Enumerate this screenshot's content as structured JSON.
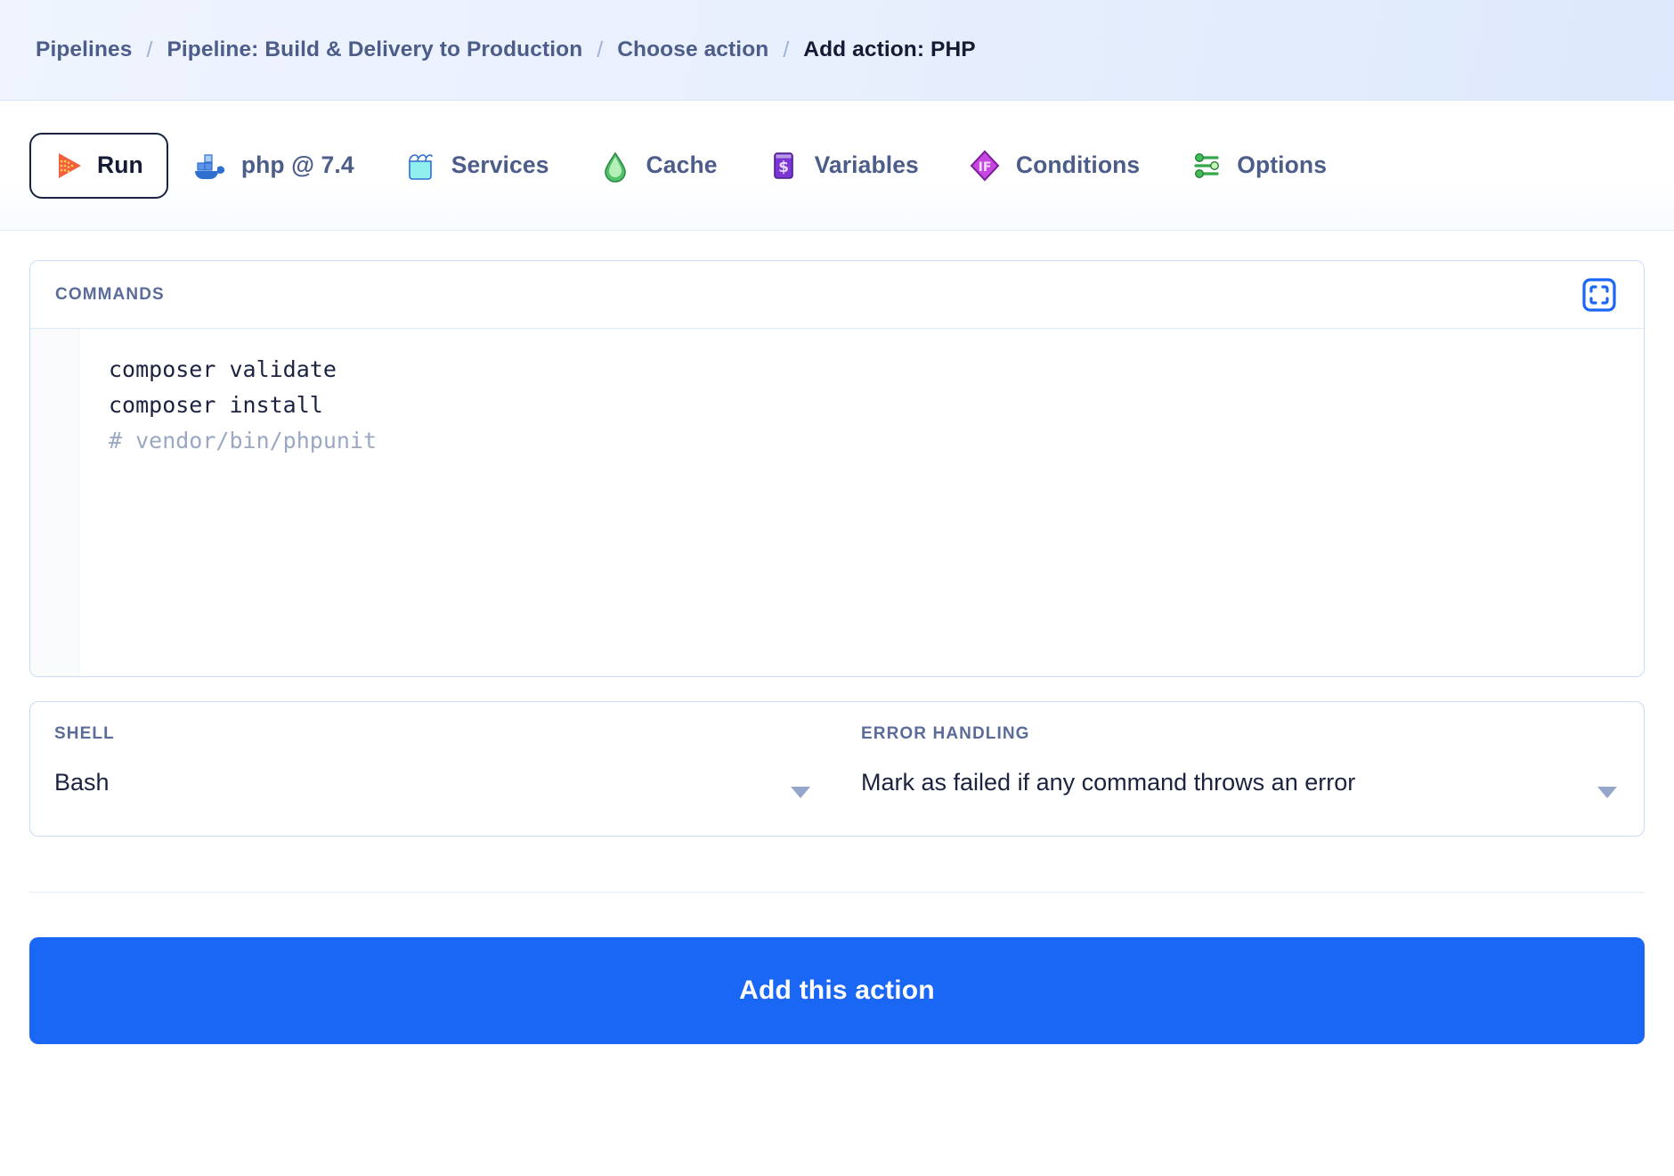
{
  "breadcrumb": {
    "separator": "/",
    "items": [
      {
        "label": "Pipelines",
        "current": false
      },
      {
        "label": "Pipeline: Build & Delivery to Production",
        "current": false
      },
      {
        "label": "Choose action",
        "current": false
      },
      {
        "label": "Add action: PHP",
        "current": true
      }
    ]
  },
  "tabs": [
    {
      "label": "Run",
      "icon": "play-icon",
      "active": true
    },
    {
      "label": "php @ 7.4",
      "icon": "docker-icon",
      "active": false
    },
    {
      "label": "Services",
      "icon": "services-icon",
      "active": false
    },
    {
      "label": "Cache",
      "icon": "cache-icon",
      "active": false
    },
    {
      "label": "Variables",
      "icon": "variables-icon",
      "active": false
    },
    {
      "label": "Conditions",
      "icon": "conditions-icon",
      "active": false
    },
    {
      "label": "Options",
      "icon": "options-icon",
      "active": false
    }
  ],
  "commands_panel": {
    "title": "COMMANDS",
    "expand_icon": "fullscreen-icon",
    "lines": [
      {
        "text": "composer validate",
        "comment": false
      },
      {
        "text": "composer install",
        "comment": false
      },
      {
        "text": "# vendor/bin/phpunit",
        "comment": true
      }
    ]
  },
  "shell": {
    "label": "SHELL",
    "value": "Bash",
    "caret_icon": "chevron-down-icon"
  },
  "error_handling": {
    "label": "ERROR HANDLING",
    "value": "Mark as failed if any command throws an error",
    "caret_icon": "chevron-down-icon"
  },
  "submit": {
    "label": "Add this action"
  },
  "colors": {
    "accent": "#1a66f5",
    "header_bg": "#e9f0fd",
    "label": "#5b6c99",
    "tab_label": "#4c5d8a",
    "text": "#141b34",
    "comment": "#9aa8c4",
    "panel_border": "#c9dbf6"
  }
}
